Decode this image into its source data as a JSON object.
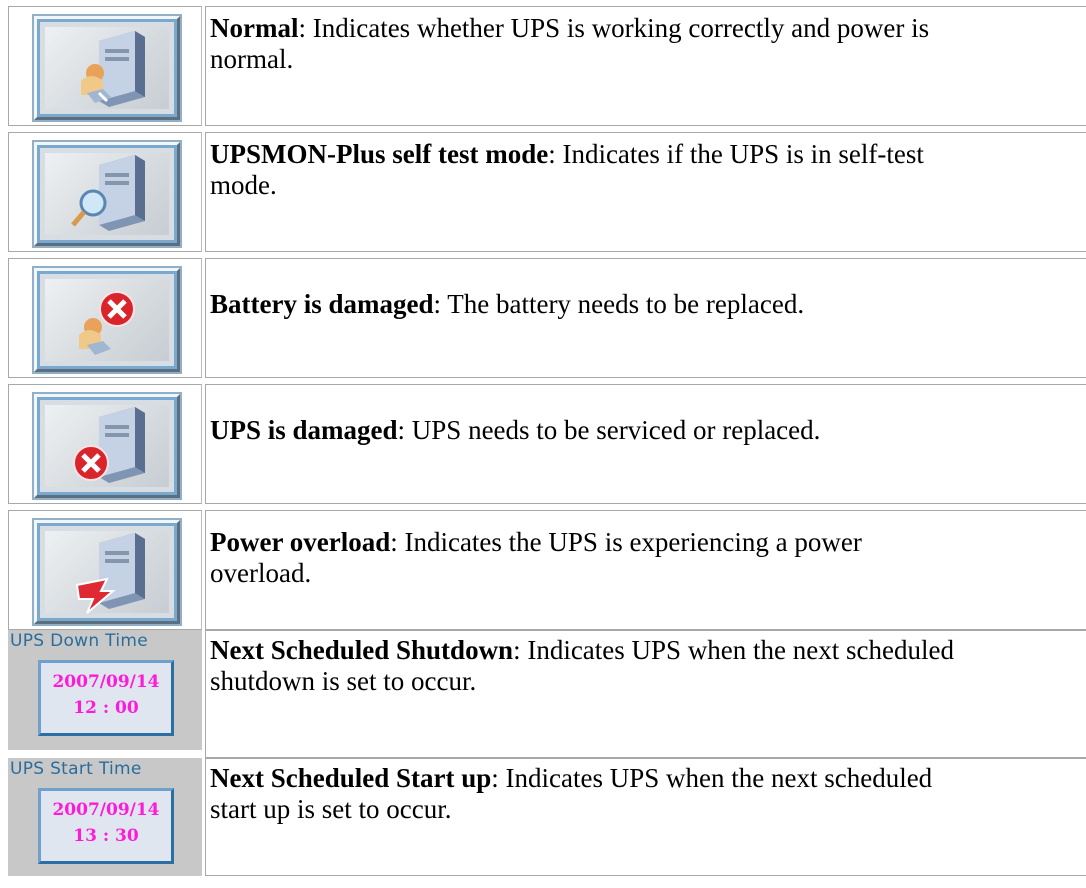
{
  "rows": [
    {
      "icon": "ups-normal-icon",
      "title": "Normal",
      "description": ": Indicates whether UPS is working correctly and power is",
      "description2": "normal."
    },
    {
      "icon": "ups-self-test-icon",
      "title": "UPSMON-Plus self test mode",
      "description": ": Indicates if the UPS is in self-test",
      "description2": "mode."
    },
    {
      "icon": "battery-damaged-icon",
      "title": "Battery is damaged",
      "description": ": The battery needs to be replaced.",
      "description2": ""
    },
    {
      "icon": "ups-damaged-icon",
      "title": "UPS is damaged",
      "description": ": UPS needs to be serviced or replaced.",
      "description2": ""
    },
    {
      "icon": "power-overload-icon",
      "title": "Power overload",
      "description": ": Indicates the UPS is experiencing a power",
      "description2": "overload."
    },
    {
      "panel_title": "UPS Down Time",
      "date": "2007/09/14",
      "time": "12 : 00",
      "title": "Next Scheduled Shutdown",
      "description": ": Indicates UPS when the next scheduled",
      "description2": "shutdown is set to occur."
    },
    {
      "panel_title": "UPS Start Time",
      "date": "2007/09/14",
      "time": "13 : 30",
      "title": "Next Scheduled Start up",
      "description": ": Indicates UPS when the next scheduled",
      "description2": "start up is set to occur."
    }
  ],
  "colors": {
    "panel_title": "#2a6c9c",
    "panel_value": "#ff1ad9",
    "error_red": "#d8242a"
  }
}
